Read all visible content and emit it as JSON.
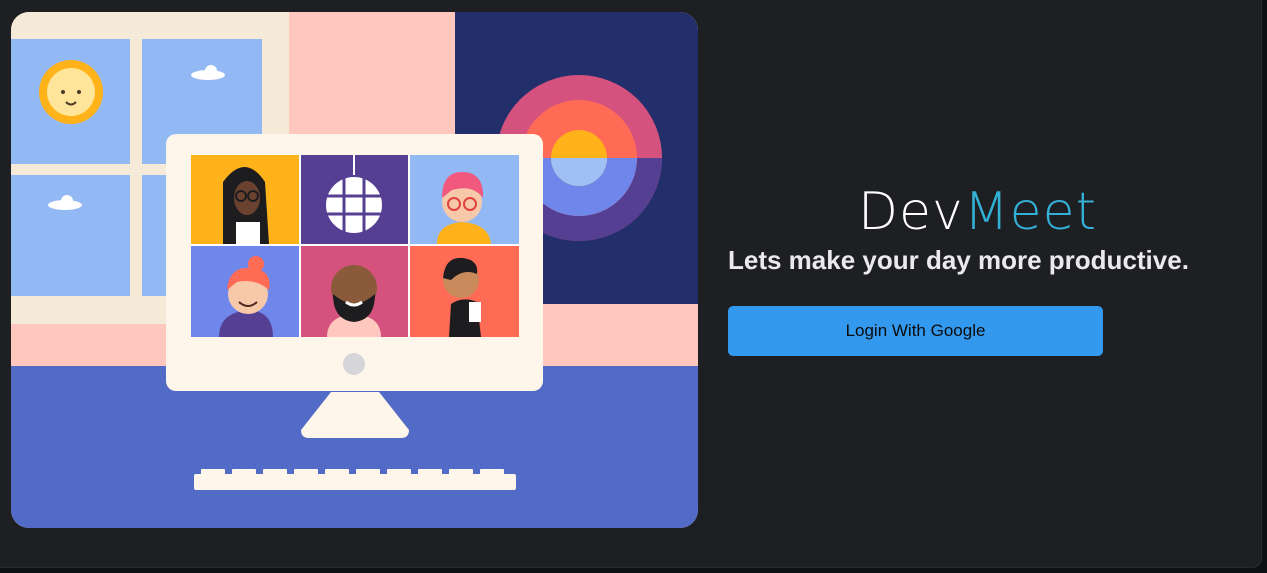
{
  "brand": {
    "dev": "Dev",
    "meet": "Meet"
  },
  "tagline": "Lets make your day more productive.",
  "login_button": {
    "label": "Login With Google"
  },
  "colors": {
    "background": "#1e1f23",
    "accent": "#33b0d6",
    "button": "#3399ee"
  },
  "illustration": {
    "icon": "video-call-illustration"
  }
}
